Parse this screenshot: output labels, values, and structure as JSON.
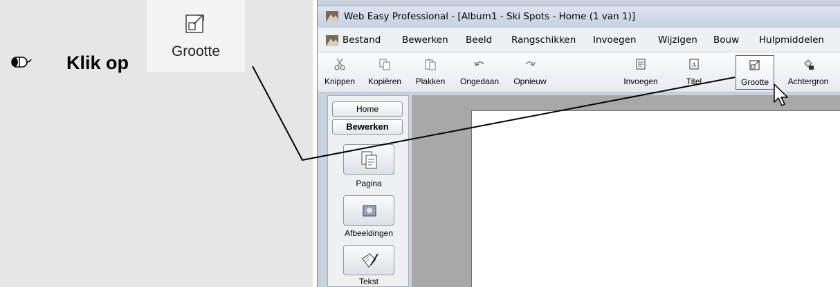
{
  "instruction": {
    "text": "Klik op",
    "button_label": "Grootte",
    "mouse_icon": "mouse-left-click-icon",
    "button_icon": "resize-icon"
  },
  "window": {
    "title": "Web Easy Professional - [Album1 - Ski Spots - Home (1 van 1)]"
  },
  "menu": {
    "items": [
      "Bestand",
      "Bewerken",
      "Beeld",
      "Rangschikken",
      "Invoegen",
      "Wijzigen",
      "Bouw",
      "Hulpmiddelen"
    ]
  },
  "toolbar": {
    "buttons": [
      {
        "label": "Knippen",
        "icon": "scissors-icon"
      },
      {
        "label": "Kopiëren",
        "icon": "copy-icon"
      },
      {
        "label": "Plakken",
        "icon": "paste-icon"
      },
      {
        "label": "Ongedaan",
        "icon": "undo-icon"
      },
      {
        "label": "Opnieuw",
        "icon": "redo-icon"
      },
      {
        "label": "Invoegen",
        "icon": "insert-icon"
      },
      {
        "label": "Titel",
        "icon": "title-icon"
      },
      {
        "label": "Grootte",
        "icon": "resize-icon",
        "active": true
      },
      {
        "label": "Achtergron",
        "icon": "background-icon"
      }
    ]
  },
  "sidebar": {
    "tabs": [
      "Home",
      "Bewerken"
    ],
    "items": [
      {
        "label": "Pagina",
        "icon": "page-icon"
      },
      {
        "label": "Afbeeldingen",
        "icon": "image-icon"
      },
      {
        "label": "Tekst",
        "icon": "text-edit-icon"
      }
    ]
  }
}
